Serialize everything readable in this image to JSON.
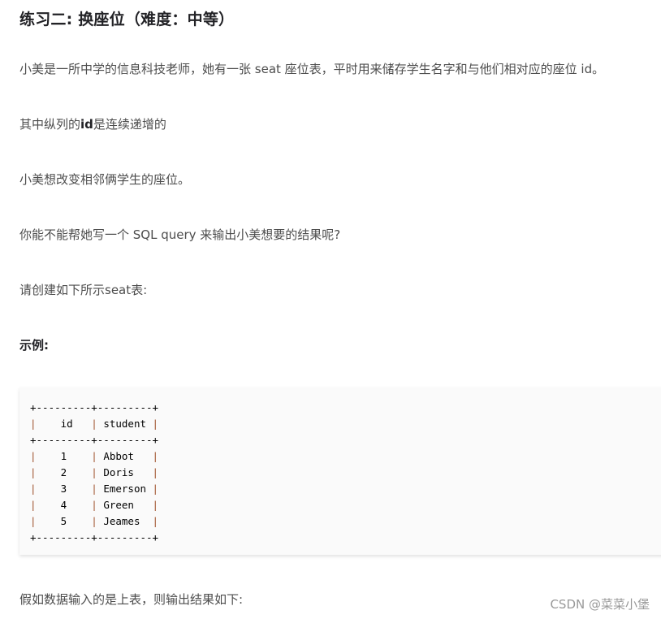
{
  "article": {
    "title": "练习二: 换座位（难度：中等）",
    "paragraphs": {
      "p1": "小美是一所中学的信息科技老师，她有一张 seat 座位表，平时用来储存学生名字和与他们相对应的座位 id。",
      "p2_before": "其中纵列的",
      "p2_bold": "id",
      "p2_after": "是连续递增的",
      "p3": "小美想改变相邻俩学生的座位。",
      "p4": "你能不能帮她写一个 SQL query 来输出小美想要的结果呢?",
      "p5": "请创建如下所示seat表:",
      "p6": "示例:",
      "p7": "假如数据输入的是上表，则输出结果如下:"
    },
    "table": {
      "border": "+---------+---------+",
      "headers": [
        "id",
        "student"
      ],
      "rows": [
        {
          "id": "1",
          "student": "Abbot"
        },
        {
          "id": "2",
          "student": "Doris"
        },
        {
          "id": "3",
          "student": "Emerson"
        },
        {
          "id": "4",
          "student": "Green"
        },
        {
          "id": "5",
          "student": "Jeames"
        }
      ]
    }
  },
  "watermark": "CSDN @菜菜小堡"
}
